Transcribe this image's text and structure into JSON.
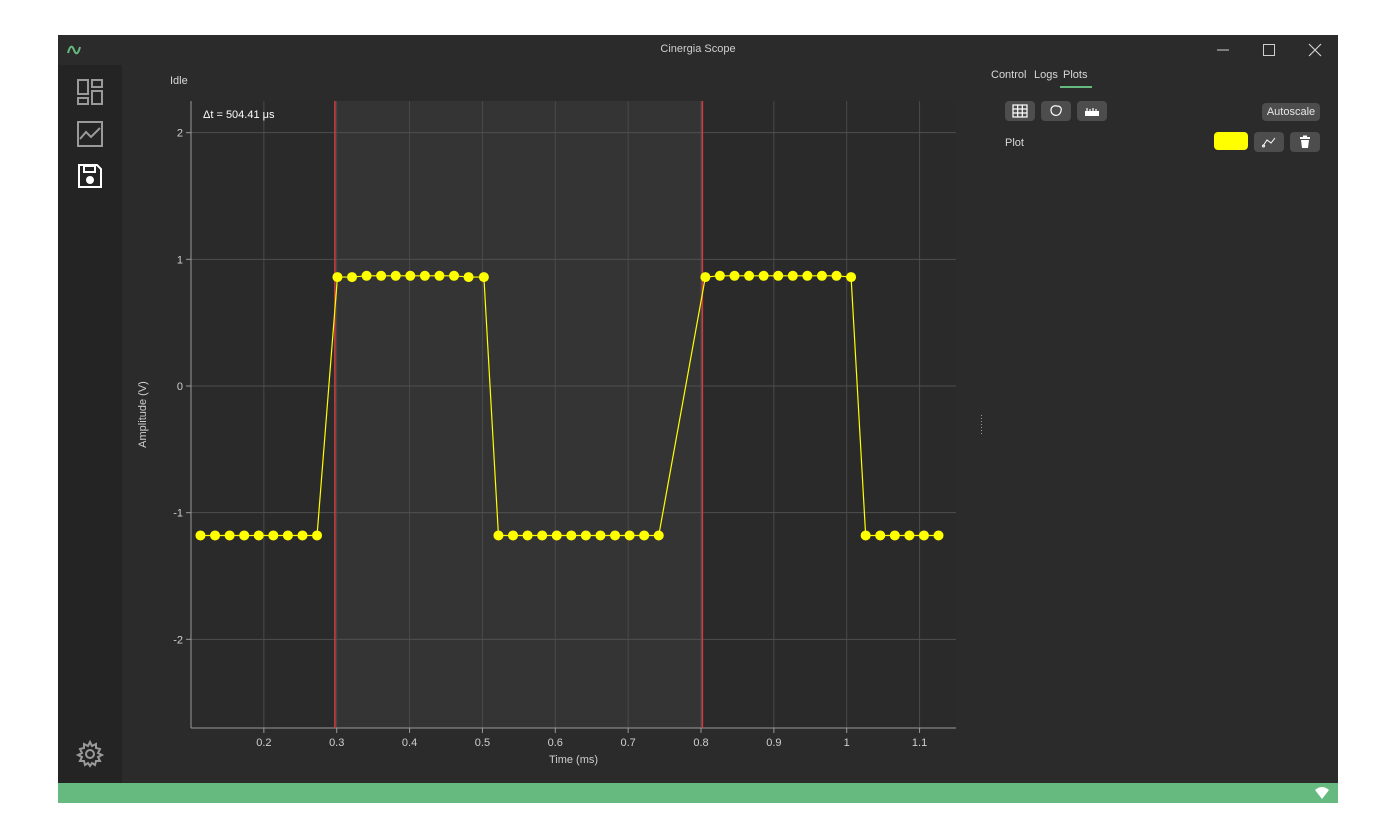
{
  "window": {
    "title": "Cinergia Scope"
  },
  "status": {
    "text": "Idle"
  },
  "cursor": {
    "delta_label": "Δt = 504.41 μs"
  },
  "tabs": [
    {
      "label": "Control"
    },
    {
      "label": "Logs"
    },
    {
      "label": "Plots",
      "active": true
    }
  ],
  "plots_panel": {
    "autoscale_label": "Autoscale",
    "plot_name": "Plot",
    "plot_color": "#ffff00"
  },
  "colors": {
    "accent": "#66b97f",
    "trace": "#ffff00",
    "cursor": "#d23c3c"
  },
  "chart_data": {
    "type": "line",
    "xlabel": "Time (ms)",
    "ylabel": "Amplitude (V)",
    "xlim": [
      0.1,
      1.15
    ],
    "ylim": [
      -2.7,
      2.25
    ],
    "x_ticks": [
      {
        "value": 0.2,
        "label": "0.2"
      },
      {
        "value": 0.3,
        "label": "0.3"
      },
      {
        "value": 0.4,
        "label": "0.4"
      },
      {
        "value": 0.5,
        "label": "0.5"
      },
      {
        "value": 0.6,
        "label": "0.6"
      },
      {
        "value": 0.7,
        "label": "0.7"
      },
      {
        "value": 0.8,
        "label": "0.8"
      },
      {
        "value": 0.9,
        "label": "0.9"
      },
      {
        "value": 1,
        "label": "1"
      },
      {
        "value": 1.1,
        "label": "1.1"
      }
    ],
    "y_ticks": [
      {
        "value": 2,
        "label": "2"
      },
      {
        "value": 1,
        "label": "1"
      },
      {
        "value": 0,
        "label": "0"
      },
      {
        "value": -1,
        "label": "-1"
      },
      {
        "value": -2,
        "label": "-2"
      }
    ],
    "grid": true,
    "cursors": [
      0.2975,
      0.8019
    ],
    "series": [
      {
        "color": "#ffff00",
        "x": [
          0.113,
          0.133,
          0.153,
          0.173,
          0.193,
          0.213,
          0.233,
          0.253,
          0.273,
          0.301,
          0.321,
          0.341,
          0.361,
          0.381,
          0.401,
          0.421,
          0.441,
          0.461,
          0.481,
          0.502,
          0.522,
          0.542,
          0.562,
          0.582,
          0.602,
          0.622,
          0.642,
          0.662,
          0.682,
          0.702,
          0.722,
          0.742,
          0.806,
          0.826,
          0.846,
          0.866,
          0.886,
          0.906,
          0.926,
          0.946,
          0.966,
          0.986,
          1.006,
          1.026,
          1.046,
          1.066,
          1.086,
          1.106,
          1.126
        ],
        "y": [
          -1.18,
          -1.18,
          -1.18,
          -1.18,
          -1.18,
          -1.18,
          -1.18,
          -1.18,
          -1.18,
          0.86,
          0.86,
          0.87,
          0.87,
          0.87,
          0.87,
          0.87,
          0.87,
          0.87,
          0.86,
          0.86,
          -1.18,
          -1.18,
          -1.18,
          -1.18,
          -1.18,
          -1.18,
          -1.18,
          -1.18,
          -1.18,
          -1.18,
          -1.18,
          -1.18,
          0.86,
          0.87,
          0.87,
          0.87,
          0.87,
          0.87,
          0.87,
          0.87,
          0.87,
          0.87,
          0.86,
          -1.18,
          -1.18,
          -1.18,
          -1.18,
          -1.18,
          -1.18
        ]
      }
    ]
  }
}
